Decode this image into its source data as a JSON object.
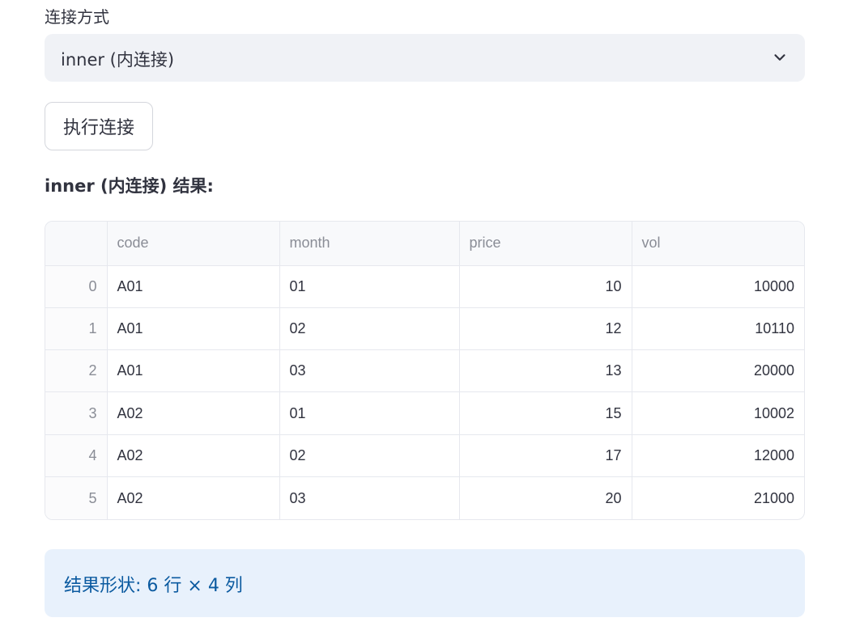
{
  "select": {
    "label": "连接方式",
    "value": "inner (内连接)"
  },
  "run_button_label": "执行连接",
  "result_title": "inner (内连接) 结果:",
  "table": {
    "columns": [
      "",
      "code",
      "month",
      "price",
      "vol"
    ],
    "rows": [
      {
        "index": "0",
        "code": "A01",
        "month": "01",
        "price": "10",
        "vol": "10000"
      },
      {
        "index": "1",
        "code": "A01",
        "month": "02",
        "price": "12",
        "vol": "10110"
      },
      {
        "index": "2",
        "code": "A01",
        "month": "03",
        "price": "13",
        "vol": "20000"
      },
      {
        "index": "3",
        "code": "A02",
        "month": "01",
        "price": "15",
        "vol": "10002"
      },
      {
        "index": "4",
        "code": "A02",
        "month": "02",
        "price": "17",
        "vol": "12000"
      },
      {
        "index": "5",
        "code": "A02",
        "month": "03",
        "price": "20",
        "vol": "21000"
      }
    ]
  },
  "info_text": "结果形状: 6 行 × 4 列",
  "colors": {
    "info_background": "#e8f1fc",
    "info_text": "#0b5aa0",
    "select_background": "#f0f2f6"
  },
  "icons": {
    "select_toggle": "chevron-down-icon"
  }
}
